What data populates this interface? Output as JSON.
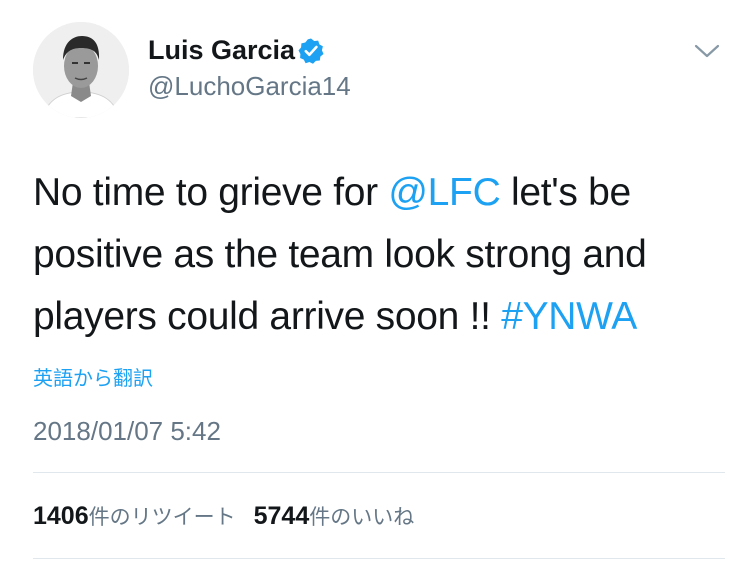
{
  "author": {
    "display_name": "Luis Garcia",
    "username": "@LuchoGarcia14",
    "verified": true
  },
  "tweet": {
    "text_1": "No time to grieve for ",
    "mention": "@LFC",
    "text_2": " let's be positive as the team look strong and players could arrive soon !! ",
    "hashtag": "#YNWA"
  },
  "translate_label": "英語から翻訳",
  "timestamp": "2018/01/07 5:42",
  "stats": {
    "retweets_count": "1406",
    "retweets_label": "件のリツイート",
    "likes_count": "5744",
    "likes_label": "件のいいね"
  },
  "icons": {
    "verified": "verified-badge-icon",
    "menu": "chevron-down-icon"
  },
  "colors": {
    "link": "#1da1f2",
    "secondary_text": "#657786",
    "primary_text": "#14171a",
    "divider": "#e1e8ed"
  }
}
